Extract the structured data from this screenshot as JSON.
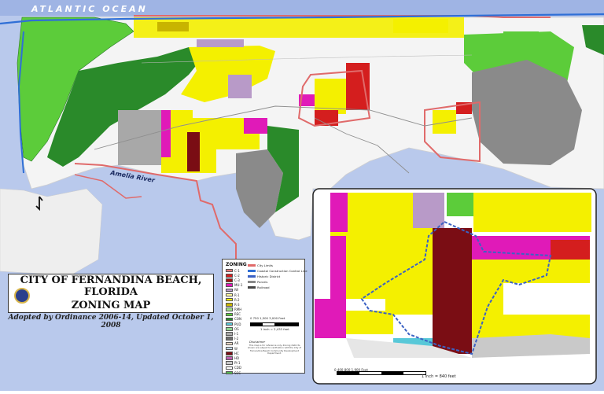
{
  "map": {
    "ocean_label": "ATLANTIC OCEAN",
    "river_label": "Amelia River",
    "colors": {
      "water": "#b9c9ec",
      "land": "#f4f4f4",
      "city_limit": "#e06a6a",
      "cccl_line": "#2f6fd6",
      "conservation_dark": "#2a8a2a",
      "conservation_light": "#5ccc3a",
      "residential": "#f4f000",
      "commercial": "#d41e1e",
      "mixed": "#e01ab8",
      "industrial": "#8a8a8a",
      "downtown": "#7a0d14",
      "public": "#b89ac8"
    }
  },
  "title": {
    "line1": "CITY OF FERNANDINA BEACH, FLORIDA",
    "line2": "ZONING MAP",
    "subtitle": "Adopted by Ordinance 2006-14, Updated October 1, 2008"
  },
  "legend": {
    "heading": "ZONING",
    "zones": [
      {
        "code": "C-1",
        "color": "#f07878"
      },
      {
        "code": "C-2",
        "color": "#d41e1e"
      },
      {
        "code": "C-3",
        "color": "#a01212"
      },
      {
        "code": "MU-1",
        "color": "#e01ab8"
      },
      {
        "code": "IW",
        "color": "#b89ac8"
      },
      {
        "code": "R-1",
        "color": "#fff8a0"
      },
      {
        "code": "R-2",
        "color": "#f4f000"
      },
      {
        "code": "R-3",
        "color": "#c8b400"
      },
      {
        "code": "RMH",
        "color": "#9fe08a"
      },
      {
        "code": "REC",
        "color": "#5ccc3a"
      },
      {
        "code": "CON",
        "color": "#2a8a2a"
      },
      {
        "code": "PUD",
        "color": "#58c8d8"
      },
      {
        "code": "OS",
        "color": "#8fd48f"
      },
      {
        "code": "I-1",
        "color": "#a8a8a8"
      },
      {
        "code": "I-2",
        "color": "#6e6e6e"
      },
      {
        "code": "AR",
        "color": "#e8d5c2"
      },
      {
        "code": "W",
        "color": "#c2d8e8"
      },
      {
        "code": "HC",
        "color": "#7a0d14"
      },
      {
        "code": "HD",
        "color": "#bf5fb0"
      },
      {
        "code": "PI-1",
        "color": "#c9c9c9"
      },
      {
        "code": "CDD",
        "color": "#ffffff"
      },
      {
        "code": "SCC",
        "color": "#55b855"
      }
    ],
    "symbols": [
      {
        "label": "City Limits",
        "color": "#e06a6a"
      },
      {
        "label": "Coastal Construction Control Line",
        "color": "#2f6fd6"
      },
      {
        "label": "Historic District",
        "color": "#3b62c4"
      },
      {
        "label": "Parcels",
        "color": "#888888"
      },
      {
        "label": "Railroad",
        "color": "#444444"
      }
    ],
    "scale_ticks": "0   750   1,500        3,000 Feet",
    "scale_ratio": "1 inch = 2,433 feet",
    "disclaimer_title": "Disclaimer",
    "disclaimer_text": "This map is for reference only. Zoning districts shown are subject to verification with the City of Fernandina Beach Community Development Department."
  },
  "inset": {
    "scale_ticks": "0        400        800                    1,900 Feet",
    "scale_ratio": "1 inch = 840 feet"
  }
}
